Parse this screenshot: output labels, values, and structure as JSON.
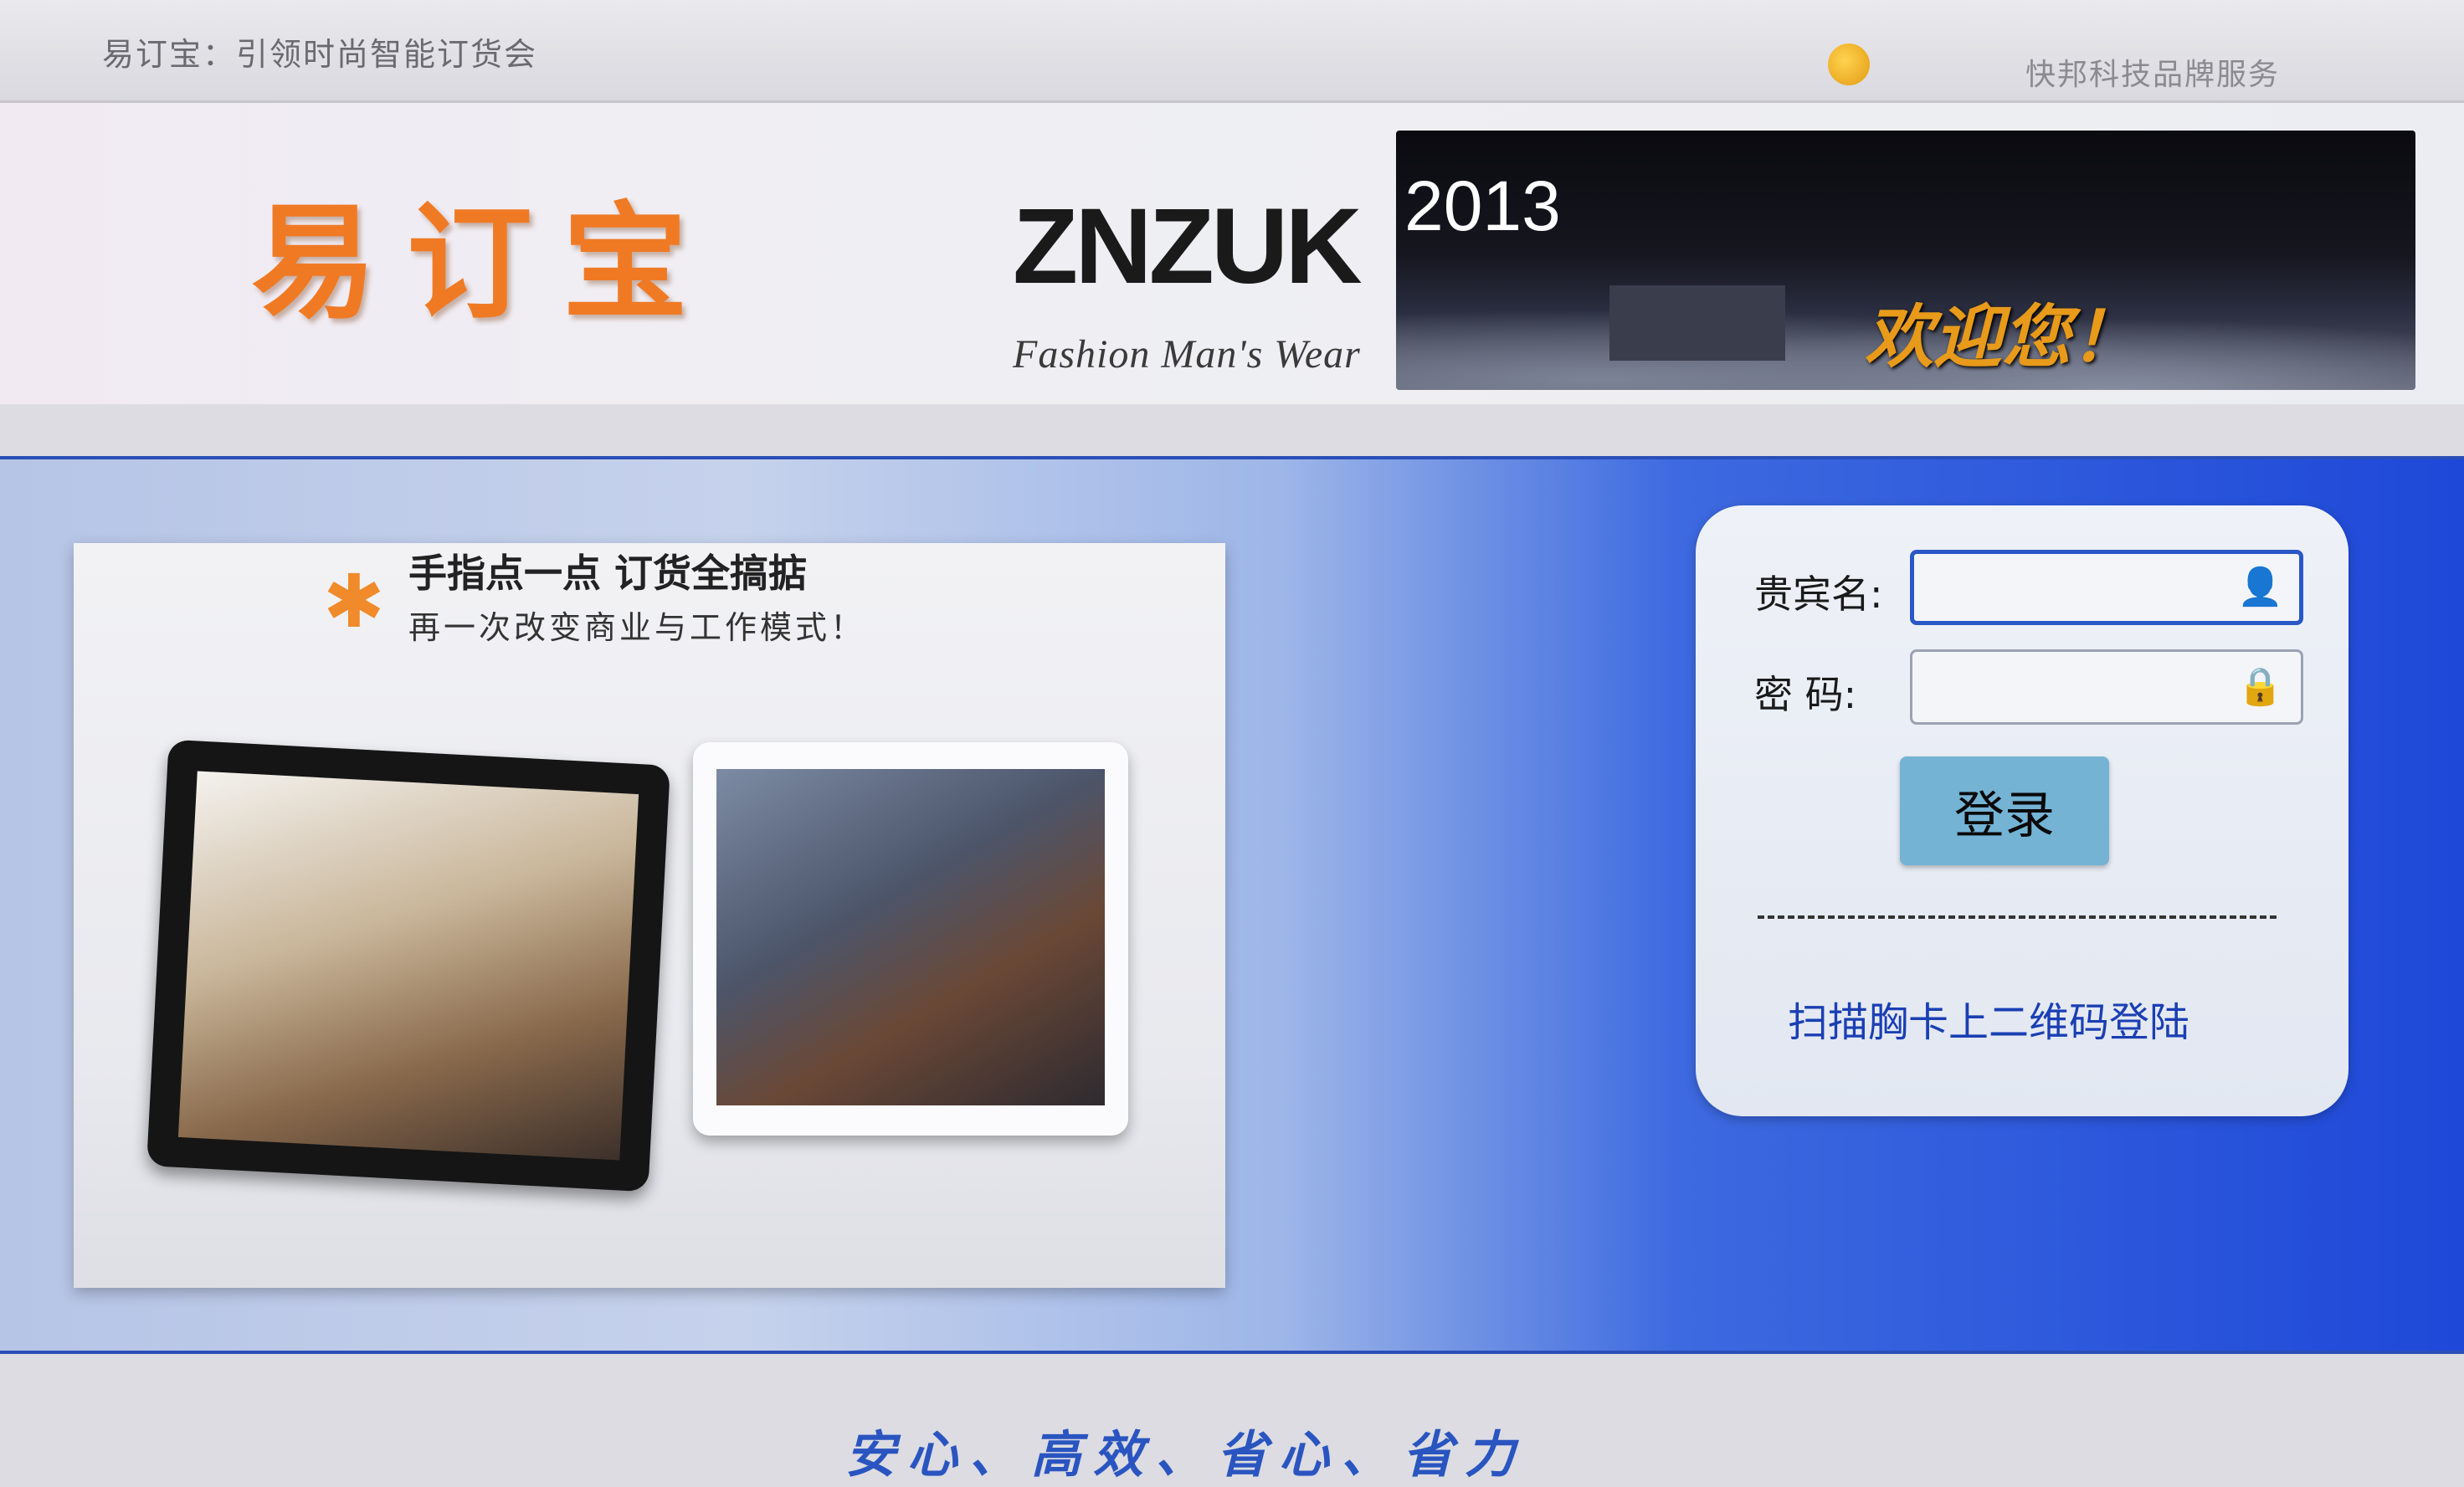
{
  "topbar": {
    "tagline": "易订宝：引领时尚智能订货会",
    "service": "快邦科技品牌服务"
  },
  "header": {
    "logo": "易订宝",
    "brand_name": "ZNZUK",
    "brand_sub": "Fashion Man's Wear",
    "banner_year": "2013",
    "banner_welcome": "欢迎您！"
  },
  "promo": {
    "title": "手指点一点 订货全搞掂",
    "subtitle": "再一次改变商业与工作模式！"
  },
  "login": {
    "username_label": "贵宾名:",
    "username_value": "",
    "password_label": "密 码:",
    "password_value": "",
    "submit_label": "登录",
    "qr_login_label": "扫描胸卡上二维码登陆"
  },
  "footer": {
    "slogan": "安心、高效、省心、省力"
  },
  "colors": {
    "logo": "#f07a24",
    "main_blue": "#1e48d8",
    "login_button": "#74b3d4",
    "link": "#1a3fb4"
  }
}
